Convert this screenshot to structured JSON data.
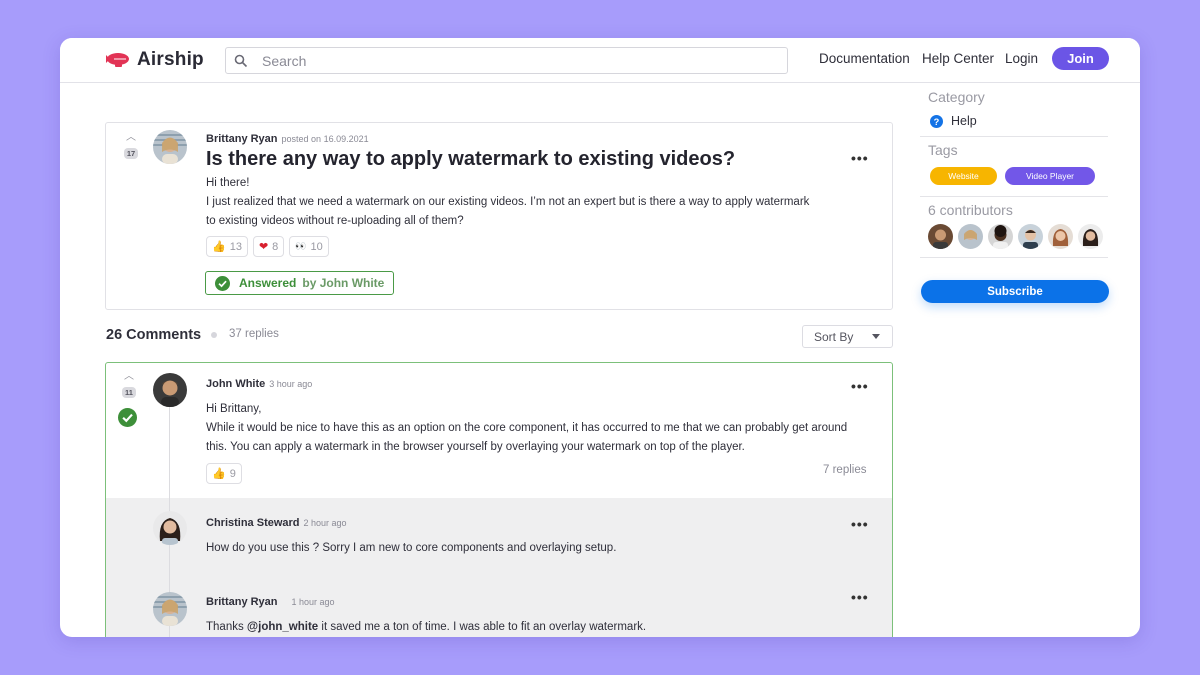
{
  "brand": {
    "name": "Airship",
    "color": "#e23355"
  },
  "search": {
    "placeholder": "Search"
  },
  "nav": {
    "documentation": "Documentation",
    "help_center": "Help Center",
    "login": "Login",
    "join": "Join"
  },
  "post": {
    "votes": "17",
    "author": "Brittany Ryan",
    "posted": "posted on 16.09.2021",
    "title": "Is there any way to apply watermark to existing videos?",
    "body_line1": "Hi there!",
    "body_line2": "I just realized that we need a watermark on our existing videos. I’m not an expert but is there a way to apply watermark",
    "body_line3": "to existing videos without re-uploading all of them?",
    "reactions": [
      {
        "icon": "thumbs-up-icon",
        "glyph": "👍",
        "count": "13"
      },
      {
        "icon": "heart-icon",
        "glyph": "❤",
        "count": "8"
      },
      {
        "icon": "eyes-icon",
        "glyph": "👀",
        "count": "10"
      }
    ],
    "answered_label": "Answered",
    "answered_by": "by John White"
  },
  "comments": {
    "title": "26 Comments",
    "replies_total": "37 replies",
    "sort_label": "Sort By"
  },
  "top_comment": {
    "votes": "11",
    "author": "John White",
    "time": "3 hour ago",
    "line1": "Hi Brittany,",
    "line2": "While it would be nice to have this as an option on the core component, it has occurred to me that we can probably get around",
    "line3": "this. You can apply a watermark in the browser yourself by overlaying your watermark on top of the player.",
    "reaction_glyph": "👍",
    "reaction_count": "9",
    "replies_link": "7 replies"
  },
  "replies": [
    {
      "author": "Christina Steward",
      "time": "2 hour ago",
      "text": "How do you use this ? Sorry I am new to core components and overlaying setup."
    },
    {
      "author": "Brittany Ryan",
      "time": "1 hour ago",
      "text_pre": "Thanks ",
      "mention": "@john_white",
      "text_post": " it saved me a ton of time. I was able to fit an overlay watermark."
    }
  ],
  "sidebar": {
    "category_label": "Category",
    "category_value": "Help",
    "tags_label": "Tags",
    "tags": [
      {
        "label": "Website",
        "color": "#f7b500"
      },
      {
        "label": "Video Player",
        "color": "#7257e8"
      }
    ],
    "contributors_label": "6 contributors",
    "subscribe": "Subscribe"
  }
}
